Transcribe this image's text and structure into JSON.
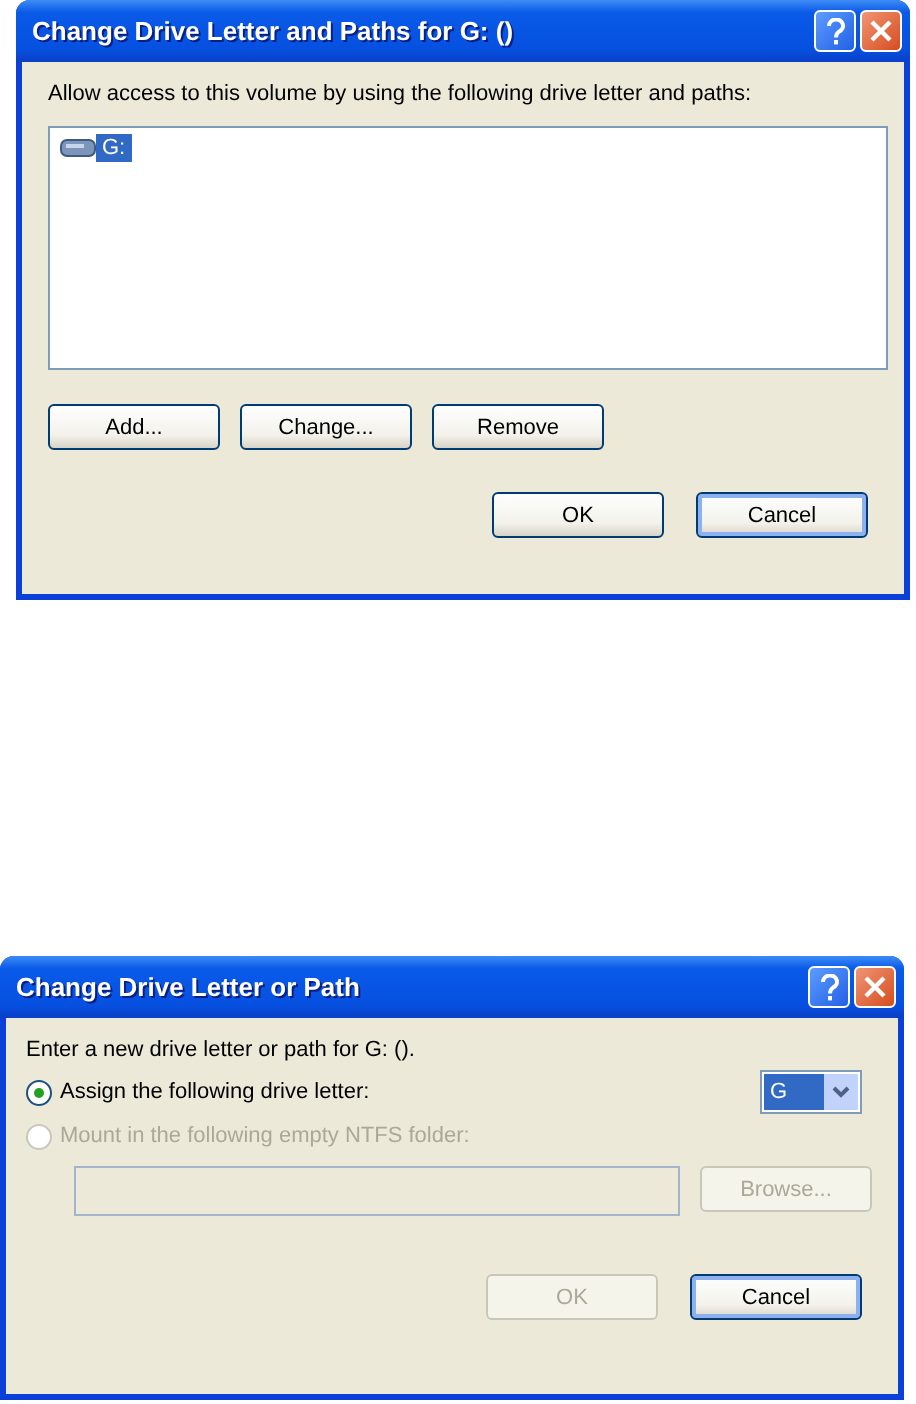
{
  "paths_dialog": {
    "title": "Change Drive Letter and Paths for G: ()",
    "prompt": "Allow access to this volume by using the following drive letter and paths:",
    "entries": [
      {
        "label": "G:",
        "selected": true
      }
    ],
    "actions": [
      {
        "label": "Add...",
        "disabled": false,
        "default": false
      },
      {
        "label": "Change...",
        "disabled": false,
        "default": false
      },
      {
        "label": "Remove",
        "disabled": false,
        "default": false
      }
    ],
    "buttons": [
      {
        "label": "OK",
        "disabled": false,
        "default": false
      },
      {
        "label": "Cancel",
        "disabled": false,
        "default": true
      }
    ]
  },
  "letter_dialog": {
    "title": "Change Drive Letter or Path",
    "prompt": "Enter a new drive letter or path for G: ().",
    "options": [
      {
        "label": "Assign the following drive letter:",
        "selected": true,
        "disabled": false
      },
      {
        "label": "Mount in the following empty NTFS folder:",
        "selected": false,
        "disabled": true
      }
    ],
    "drive_letter": {
      "value": "G"
    },
    "folder_field": {
      "disabled": true
    },
    "browse": {
      "label": "Browse...",
      "disabled": true
    },
    "buttons": [
      {
        "label": "OK",
        "disabled": true,
        "default": false
      },
      {
        "label": "Cancel",
        "disabled": false,
        "default": true
      }
    ]
  }
}
